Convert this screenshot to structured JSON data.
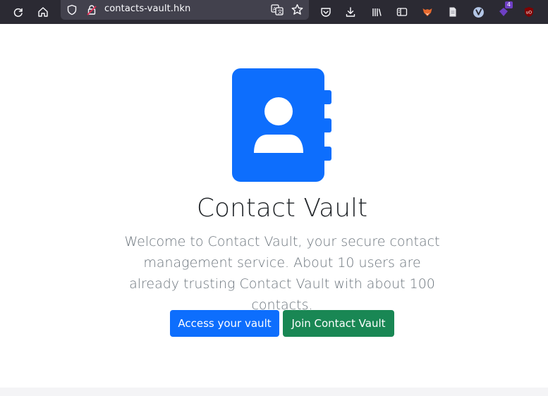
{
  "browser": {
    "url": "contacts-vault.hkn",
    "extension_badge_count": "4",
    "colors": {
      "toolbar": "#2b2a33",
      "urlbar": "#42414d",
      "icon": "#fbfbfe"
    }
  },
  "hero": {
    "logo_icon": "contact-book-icon",
    "title": "Contact Vault",
    "lead": "Welcome to Contact Vault, your secure contact management service. About 10 users are already trusting Contact Vault with about 100 contacts."
  },
  "actions": {
    "access_label": "Access your vault",
    "join_label": "Join Contact Vault"
  },
  "colors": {
    "primary": "#0d6efd",
    "success": "#198754",
    "title": "#212529",
    "lead": "#6c757d"
  }
}
